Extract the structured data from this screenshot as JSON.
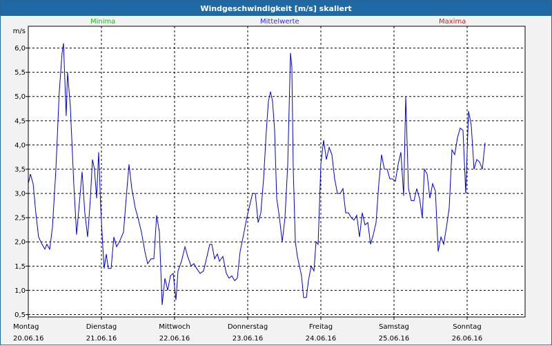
{
  "window": {
    "title": "Windgeschwindigkeit [m/s] skaliert"
  },
  "legend": [
    {
      "label": "Minima",
      "color": "#22bb22"
    },
    {
      "label": "Mittelwerte",
      "color": "#3333cc"
    },
    {
      "label": "Maxima",
      "color": "#cc2222"
    }
  ],
  "chart_data": {
    "type": "line",
    "title": "Windgeschwindigkeit [m/s] skaliert",
    "ylabel": "m/s",
    "ylim": [
      0.45,
      6.45
    ],
    "y_ticks": [
      "0.5",
      "1.0",
      "1.5",
      "2.0",
      "2.5",
      "3.0",
      "3.5",
      "4.0",
      "4.5",
      "5.0",
      "5.5",
      "6.0"
    ],
    "y_tick_labels": [
      "0,5",
      "1,0",
      "1,5",
      "2,0",
      "2,5",
      "3,0",
      "3,5",
      "4,0",
      "4,5",
      "5,0",
      "5,5",
      "6,0"
    ],
    "x_range_days": [
      0,
      7
    ],
    "x_ticks": [
      {
        "day": "Montag",
        "date": "20.06.16"
      },
      {
        "day": "Dienstag",
        "date": "21.06.16"
      },
      {
        "day": "Mittwoch",
        "date": "22.06.16"
      },
      {
        "day": "Donnerstag",
        "date": "23.06.16"
      },
      {
        "day": "Freitag",
        "date": "24.06.16"
      },
      {
        "day": "Samstag",
        "date": "25.06.16"
      },
      {
        "day": "Sonntag",
        "date": "26.06.16"
      }
    ],
    "grid": true,
    "series": [
      {
        "color": "#0000cc",
        "points": [
          [
            0.0,
            3.2
          ],
          [
            0.028,
            3.4
          ],
          [
            0.066,
            3.2
          ],
          [
            0.103,
            2.6
          ],
          [
            0.141,
            2.1
          ],
          [
            0.188,
            1.95
          ],
          [
            0.226,
            1.85
          ],
          [
            0.254,
            1.95
          ],
          [
            0.292,
            1.85
          ],
          [
            0.33,
            2.3
          ],
          [
            0.377,
            3.5
          ],
          [
            0.424,
            5.1
          ],
          [
            0.462,
            5.9
          ],
          [
            0.481,
            6.1
          ],
          [
            0.518,
            4.6
          ],
          [
            0.537,
            5.5
          ],
          [
            0.575,
            4.8
          ],
          [
            0.622,
            3.2
          ],
          [
            0.66,
            2.15
          ],
          [
            0.698,
            2.8
          ],
          [
            0.736,
            3.45
          ],
          [
            0.773,
            2.6
          ],
          [
            0.811,
            2.1
          ],
          [
            0.849,
            2.9
          ],
          [
            0.877,
            3.7
          ],
          [
            0.905,
            3.5
          ],
          [
            0.934,
            2.9
          ],
          [
            0.962,
            3.85
          ],
          [
            0.991,
            2.7
          ],
          [
            1.019,
            1.9
          ],
          [
            1.038,
            1.45
          ],
          [
            1.066,
            1.75
          ],
          [
            1.094,
            1.45
          ],
          [
            1.132,
            1.45
          ],
          [
            1.17,
            2.1
          ],
          [
            1.208,
            1.9
          ],
          [
            1.245,
            2.0
          ],
          [
            1.302,
            2.2
          ],
          [
            1.349,
            3.1
          ],
          [
            1.377,
            3.6
          ],
          [
            1.415,
            3.1
          ],
          [
            1.462,
            2.7
          ],
          [
            1.5,
            2.5
          ],
          [
            1.547,
            2.2
          ],
          [
            1.594,
            1.8
          ],
          [
            1.632,
            1.55
          ],
          [
            1.679,
            1.65
          ],
          [
            1.717,
            1.65
          ],
          [
            1.755,
            2.55
          ],
          [
            1.792,
            2.2
          ],
          [
            1.83,
            0.7
          ],
          [
            1.868,
            1.25
          ],
          [
            1.906,
            1.0
          ],
          [
            1.943,
            1.3
          ],
          [
            1.981,
            1.35
          ],
          [
            2.019,
            0.8
          ],
          [
            2.047,
            1.4
          ],
          [
            2.094,
            1.6
          ],
          [
            2.142,
            1.9
          ],
          [
            2.179,
            1.7
          ],
          [
            2.226,
            1.5
          ],
          [
            2.264,
            1.55
          ],
          [
            2.302,
            1.45
          ],
          [
            2.349,
            1.35
          ],
          [
            2.396,
            1.4
          ],
          [
            2.443,
            1.7
          ],
          [
            2.481,
            1.95
          ],
          [
            2.509,
            1.95
          ],
          [
            2.547,
            1.65
          ],
          [
            2.585,
            1.75
          ],
          [
            2.613,
            1.6
          ],
          [
            2.66,
            1.7
          ],
          [
            2.708,
            1.35
          ],
          [
            2.745,
            1.25
          ],
          [
            2.783,
            1.3
          ],
          [
            2.821,
            1.2
          ],
          [
            2.858,
            1.25
          ],
          [
            2.896,
            1.8
          ],
          [
            2.943,
            2.15
          ],
          [
            2.981,
            2.45
          ],
          [
            3.019,
            2.7
          ],
          [
            3.066,
            3.0
          ],
          [
            3.104,
            3.0
          ],
          [
            3.142,
            2.4
          ],
          [
            3.179,
            2.6
          ],
          [
            3.217,
            3.3
          ],
          [
            3.255,
            4.3
          ],
          [
            3.283,
            4.9
          ],
          [
            3.311,
            5.1
          ],
          [
            3.34,
            4.9
          ],
          [
            3.368,
            4.3
          ],
          [
            3.396,
            2.9
          ],
          [
            3.434,
            2.5
          ],
          [
            3.472,
            2.0
          ],
          [
            3.509,
            2.5
          ],
          [
            3.547,
            3.6
          ],
          [
            3.585,
            5.9
          ],
          [
            3.604,
            5.6
          ],
          [
            3.623,
            3.5
          ],
          [
            3.651,
            2.0
          ],
          [
            3.679,
            1.7
          ],
          [
            3.708,
            1.5
          ],
          [
            3.736,
            1.3
          ],
          [
            3.764,
            0.85
          ],
          [
            3.802,
            0.85
          ],
          [
            3.83,
            1.2
          ],
          [
            3.868,
            1.5
          ],
          [
            3.906,
            1.4
          ],
          [
            3.934,
            2.0
          ],
          [
            3.962,
            1.95
          ],
          [
            4.0,
            3.6
          ],
          [
            4.038,
            4.1
          ],
          [
            4.075,
            3.7
          ],
          [
            4.113,
            3.95
          ],
          [
            4.151,
            3.8
          ],
          [
            4.189,
            3.3
          ],
          [
            4.226,
            3.0
          ],
          [
            4.264,
            3.0
          ],
          [
            4.302,
            3.1
          ],
          [
            4.34,
            2.6
          ],
          [
            4.377,
            2.6
          ],
          [
            4.415,
            2.5
          ],
          [
            4.453,
            2.45
          ],
          [
            4.491,
            2.55
          ],
          [
            4.528,
            2.1
          ],
          [
            4.566,
            2.6
          ],
          [
            4.604,
            2.35
          ],
          [
            4.642,
            2.4
          ],
          [
            4.679,
            1.95
          ],
          [
            4.717,
            2.15
          ],
          [
            4.755,
            2.4
          ],
          [
            4.792,
            3.2
          ],
          [
            4.83,
            3.8
          ],
          [
            4.868,
            3.5
          ],
          [
            4.906,
            3.5
          ],
          [
            4.943,
            3.3
          ],
          [
            4.981,
            3.3
          ],
          [
            5.019,
            3.25
          ],
          [
            5.057,
            3.6
          ],
          [
            5.094,
            3.85
          ],
          [
            5.132,
            2.95
          ],
          [
            5.16,
            5.0
          ],
          [
            5.198,
            3.1
          ],
          [
            5.236,
            2.85
          ],
          [
            5.274,
            2.85
          ],
          [
            5.311,
            3.1
          ],
          [
            5.349,
            2.9
          ],
          [
            5.387,
            2.5
          ],
          [
            5.415,
            3.5
          ],
          [
            5.453,
            3.4
          ],
          [
            5.491,
            2.9
          ],
          [
            5.528,
            3.2
          ],
          [
            5.566,
            3.05
          ],
          [
            5.604,
            1.8
          ],
          [
            5.642,
            2.1
          ],
          [
            5.679,
            1.95
          ],
          [
            5.717,
            2.3
          ],
          [
            5.755,
            2.7
          ],
          [
            5.792,
            3.9
          ],
          [
            5.83,
            3.8
          ],
          [
            5.868,
            4.15
          ],
          [
            5.906,
            4.35
          ],
          [
            5.943,
            4.3
          ],
          [
            5.981,
            3.0
          ],
          [
            6.019,
            4.7
          ],
          [
            6.057,
            4.4
          ],
          [
            6.094,
            3.5
          ],
          [
            6.132,
            3.7
          ],
          [
            6.17,
            3.65
          ],
          [
            6.208,
            3.5
          ],
          [
            6.245,
            4.05
          ]
        ]
      }
    ]
  }
}
